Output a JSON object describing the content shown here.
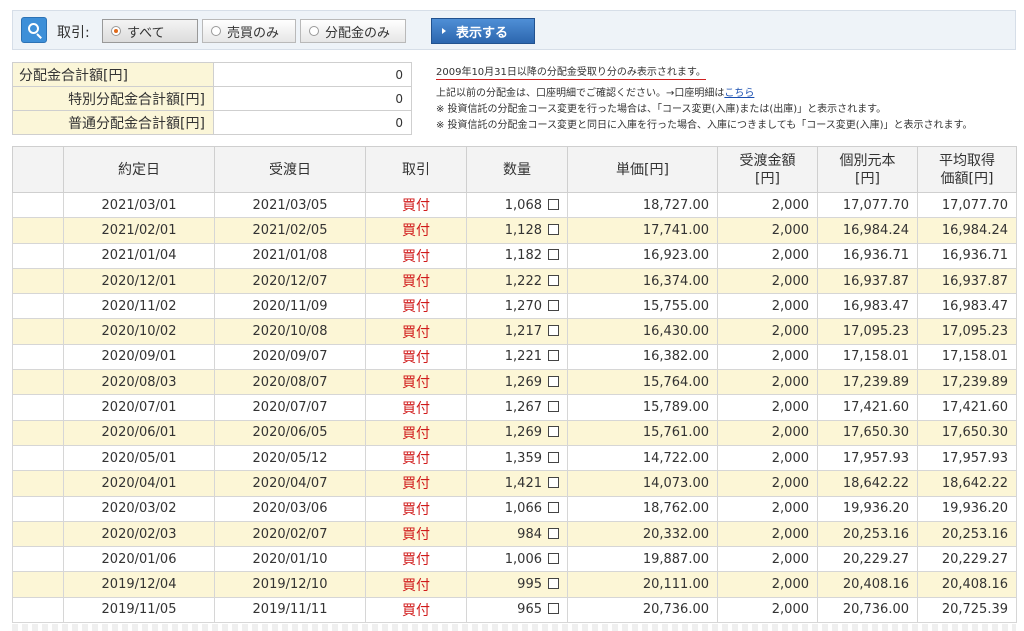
{
  "filter": {
    "label": "取引:",
    "options": [
      {
        "label": "すべて",
        "selected": true
      },
      {
        "label": "売買のみ",
        "selected": false
      },
      {
        "label": "分配金のみ",
        "selected": false
      }
    ],
    "show_button": "表示する"
  },
  "summary": [
    {
      "label": "分配金合計額[円]",
      "value": "0"
    },
    {
      "label": "特別分配金合計額[円]",
      "value": "0"
    },
    {
      "label": "普通分配金合計額[円]",
      "value": "0"
    }
  ],
  "notes": {
    "top": "2009年10月31日以降の分配金受取り分のみ表示されます。",
    "line1": "上記以前の分配金は、口座明細でご確認ください。→口座明細は",
    "line1_link": "こちら",
    "line2": "※ 投資信託の分配金コース変更を行った場合は、「コース変更(入庫)または(出庫)」と表示されます。",
    "line3": "※ 投資信託の分配金コース変更と同日に入庫を行った場合、入庫につきましても「コース変更(入庫)」と表示されます。"
  },
  "table": {
    "headers": [
      "",
      "約定日",
      "受渡日",
      "取引",
      "数量",
      "単価[円]",
      "受渡金額\n[円]",
      "個別元本\n[円]",
      "平均取得\n価額[円]"
    ],
    "rows": [
      {
        "contract": "2021/03/01",
        "delivery": "2021/03/05",
        "trade": "買付",
        "qty": "1,068",
        "price": "18,727.00",
        "amount": "2,000",
        "principal": "17,077.70",
        "avg": "17,077.70"
      },
      {
        "contract": "2021/02/01",
        "delivery": "2021/02/05",
        "trade": "買付",
        "qty": "1,128",
        "price": "17,741.00",
        "amount": "2,000",
        "principal": "16,984.24",
        "avg": "16,984.24"
      },
      {
        "contract": "2021/01/04",
        "delivery": "2021/01/08",
        "trade": "買付",
        "qty": "1,182",
        "price": "16,923.00",
        "amount": "2,000",
        "principal": "16,936.71",
        "avg": "16,936.71"
      },
      {
        "contract": "2020/12/01",
        "delivery": "2020/12/07",
        "trade": "買付",
        "qty": "1,222",
        "price": "16,374.00",
        "amount": "2,000",
        "principal": "16,937.87",
        "avg": "16,937.87"
      },
      {
        "contract": "2020/11/02",
        "delivery": "2020/11/09",
        "trade": "買付",
        "qty": "1,270",
        "price": "15,755.00",
        "amount": "2,000",
        "principal": "16,983.47",
        "avg": "16,983.47"
      },
      {
        "contract": "2020/10/02",
        "delivery": "2020/10/08",
        "trade": "買付",
        "qty": "1,217",
        "price": "16,430.00",
        "amount": "2,000",
        "principal": "17,095.23",
        "avg": "17,095.23"
      },
      {
        "contract": "2020/09/01",
        "delivery": "2020/09/07",
        "trade": "買付",
        "qty": "1,221",
        "price": "16,382.00",
        "amount": "2,000",
        "principal": "17,158.01",
        "avg": "17,158.01"
      },
      {
        "contract": "2020/08/03",
        "delivery": "2020/08/07",
        "trade": "買付",
        "qty": "1,269",
        "price": "15,764.00",
        "amount": "2,000",
        "principal": "17,239.89",
        "avg": "17,239.89"
      },
      {
        "contract": "2020/07/01",
        "delivery": "2020/07/07",
        "trade": "買付",
        "qty": "1,267",
        "price": "15,789.00",
        "amount": "2,000",
        "principal": "17,421.60",
        "avg": "17,421.60"
      },
      {
        "contract": "2020/06/01",
        "delivery": "2020/06/05",
        "trade": "買付",
        "qty": "1,269",
        "price": "15,761.00",
        "amount": "2,000",
        "principal": "17,650.30",
        "avg": "17,650.30"
      },
      {
        "contract": "2020/05/01",
        "delivery": "2020/05/12",
        "trade": "買付",
        "qty": "1,359",
        "price": "14,722.00",
        "amount": "2,000",
        "principal": "17,957.93",
        "avg": "17,957.93"
      },
      {
        "contract": "2020/04/01",
        "delivery": "2020/04/07",
        "trade": "買付",
        "qty": "1,421",
        "price": "14,073.00",
        "amount": "2,000",
        "principal": "18,642.22",
        "avg": "18,642.22"
      },
      {
        "contract": "2020/03/02",
        "delivery": "2020/03/06",
        "trade": "買付",
        "qty": "1,066",
        "price": "18,762.00",
        "amount": "2,000",
        "principal": "19,936.20",
        "avg": "19,936.20"
      },
      {
        "contract": "2020/02/03",
        "delivery": "2020/02/07",
        "trade": "買付",
        "qty": "984",
        "price": "20,332.00",
        "amount": "2,000",
        "principal": "20,253.16",
        "avg": "20,253.16"
      },
      {
        "contract": "2020/01/06",
        "delivery": "2020/01/10",
        "trade": "買付",
        "qty": "1,006",
        "price": "19,887.00",
        "amount": "2,000",
        "principal": "20,229.27",
        "avg": "20,229.27"
      },
      {
        "contract": "2019/12/04",
        "delivery": "2019/12/10",
        "trade": "買付",
        "qty": "995",
        "price": "20,111.00",
        "amount": "2,000",
        "principal": "20,408.16",
        "avg": "20,408.16"
      },
      {
        "contract": "2019/11/05",
        "delivery": "2019/11/11",
        "trade": "買付",
        "qty": "965",
        "price": "20,736.00",
        "amount": "2,000",
        "principal": "20,736.00",
        "avg": "20,725.39"
      }
    ]
  },
  "colors": {
    "accent": "#2c66ae",
    "trade_text": "#d01a1a",
    "row_alt": "#fcf6d6",
    "label_bg": "#fbf6d8"
  },
  "icons": {
    "search": "search-icon",
    "quantity_checkbox": "checkbox-icon"
  }
}
